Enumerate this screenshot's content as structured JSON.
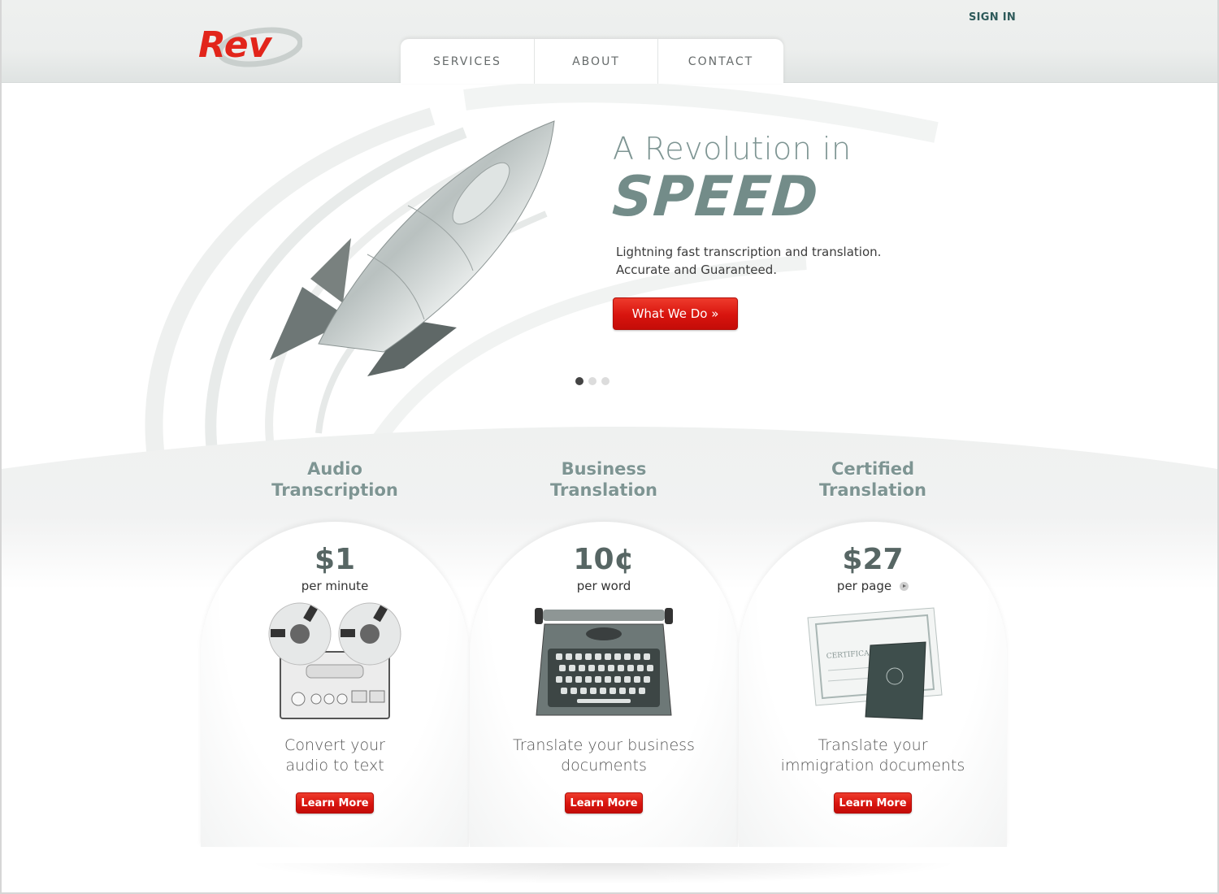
{
  "header": {
    "logo_text": "Rev",
    "sign_in": "SIGN IN",
    "nav": [
      {
        "label": "SERVICES"
      },
      {
        "label": "ABOUT"
      },
      {
        "label": "CONTACT"
      }
    ]
  },
  "hero": {
    "title_line1": "A Revolution in",
    "title_line2": "SPEED",
    "subtitle_line1": "Lightning fast transcription and translation.",
    "subtitle_line2": "Accurate and Guaranteed.",
    "cta_label": "What We Do »",
    "image": "rocket-illustration",
    "carousel": {
      "total": 3,
      "active": 1
    }
  },
  "services": [
    {
      "title_line1": "Audio",
      "title_line2": "Transcription",
      "price": "$1",
      "unit": "per minute",
      "image": "reel-to-reel-tape-recorder",
      "desc_line1": "Convert your",
      "desc_line2": "audio to text",
      "button": "Learn More"
    },
    {
      "title_line1": "Business",
      "title_line2": "Translation",
      "price": "10¢",
      "unit": "per word",
      "image": "typewriter",
      "desc_line1": "Translate your business",
      "desc_line2": "documents",
      "button": "Learn More"
    },
    {
      "title_line1": "Certified",
      "title_line2": "Translation",
      "price": "$27",
      "unit": "per page",
      "unit_icon": "play-info-icon",
      "image": "certificate-and-passport",
      "desc_line1": "Translate your",
      "desc_line2": "immigration documents",
      "button": "Learn More"
    }
  ],
  "colors": {
    "brand_red": "#e2251b",
    "heading_teal": "#7e9593",
    "price_gray": "#576664",
    "signin_teal": "#2e5a5a"
  }
}
